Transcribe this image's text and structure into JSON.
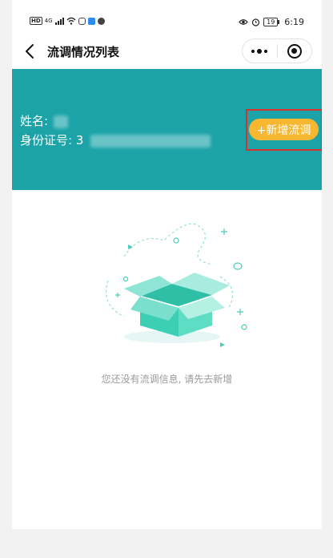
{
  "status_bar": {
    "hd": "HD",
    "net": "4G",
    "battery": "19",
    "time": "6:19"
  },
  "nav": {
    "title": "流调情况列表"
  },
  "info": {
    "name_label": "姓名:",
    "id_label": "身份证号:",
    "id_visible_prefix": "3"
  },
  "actions": {
    "add_label": "+新增流调"
  },
  "empty_state": {
    "message": "您还没有流调信息, 请先去新增"
  },
  "colors": {
    "header_bg": "#1ba3a8",
    "add_button": "#f7b731",
    "highlight": "#d9312b",
    "box_teal": "#3ccfb5"
  },
  "icons": [
    "back-arrow-icon",
    "more-dots-icon",
    "target-icon",
    "empty-box-icon"
  ]
}
